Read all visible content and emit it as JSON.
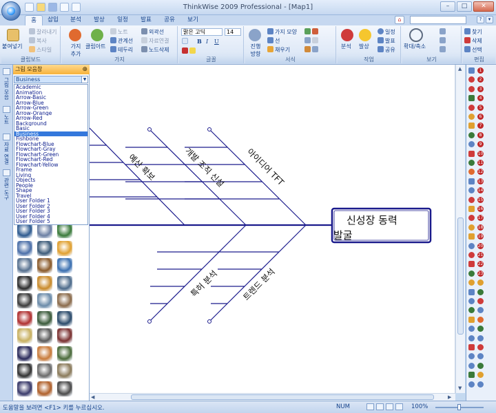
{
  "app": {
    "window_title": "ThinkWise 2009 Professional - [Map1]",
    "window_controls": [
      "–",
      "□",
      "✕"
    ]
  },
  "tabs": [
    "홈",
    "삽입",
    "분석",
    "발상",
    "일정",
    "발표",
    "공유",
    "보기"
  ],
  "active_tab": "홈",
  "ribbon": {
    "clipboard": {
      "paste": "붙여넣기",
      "cut": "잘라내기",
      "copy": "복사",
      "style": "스타일",
      "label": "클립보드"
    },
    "branch": {
      "add_branch": "가지 추가",
      "clipart": "클립아트",
      "note": "노트",
      "relation": "관계선",
      "border": "테두리",
      "outline": "외곽선",
      "data_link": "자료연결",
      "delete_node": "노드삭제",
      "label": "가지"
    },
    "font": {
      "font_name": "맑은 고딕",
      "font_size": "14",
      "bold": "B",
      "italic": "I",
      "underline": "U",
      "label": "글꼴"
    },
    "format": {
      "branch_shape": "가지 모양",
      "line": "선",
      "fill": "채우기",
      "layout": "진행 방향",
      "label": "서식"
    },
    "work": {
      "analyze": "분석",
      "idea": "발상",
      "schedule": "일정",
      "presentation": "발표",
      "share": "공유",
      "label": "작업"
    },
    "view": {
      "zoom": "확대/축소",
      "label": "보기"
    },
    "edit": {
      "find": "찾기",
      "delete": "삭제",
      "select": "선택",
      "label": "편집"
    }
  },
  "left_rail": [
    "그림 모음",
    "노트",
    "자료 연결",
    "관련 도구"
  ],
  "gallery": {
    "header": "그림 모음창",
    "pin": "⊕",
    "selected": "Business",
    "categories": [
      "Academic",
      "Animation",
      "Arrow-Basic",
      "Arrow-Blue",
      "Arrow-Green",
      "Arrow-Orange",
      "Arrow-Red",
      "Background",
      "Basic",
      "Business",
      "Fishbone",
      "Flowchart-Blue",
      "Flowchart-Gray",
      "Flowchart-Green",
      "Flowchart-Red",
      "Flowchart-Yellow",
      "Frame",
      "Living",
      "Objects",
      "People",
      "Shape",
      "Travel",
      "User Folder 1",
      "User Folder 2",
      "User Folder 3",
      "User Folder 4",
      "User Folder 5"
    ]
  },
  "map": {
    "central_topic": {
      "line1": "신성장 동력",
      "line2": "발굴"
    },
    "branches": [
      "예산 확보",
      "개발 조직 신설",
      "아이디어 TFT",
      "특허 분석",
      "트렌드 분석"
    ]
  },
  "status": {
    "help_text": "도움말을 보려면 <F1> 키를 누르십시오.",
    "num_lock": "NUM",
    "zoom_percent": "100%"
  },
  "colors": {
    "accent": "#15428b",
    "ribbon_bg": "#dfe9f7",
    "gallery_header": "#f7b23c",
    "map_line": "#1a1a8c",
    "topic_border": "#1a1a8c"
  }
}
